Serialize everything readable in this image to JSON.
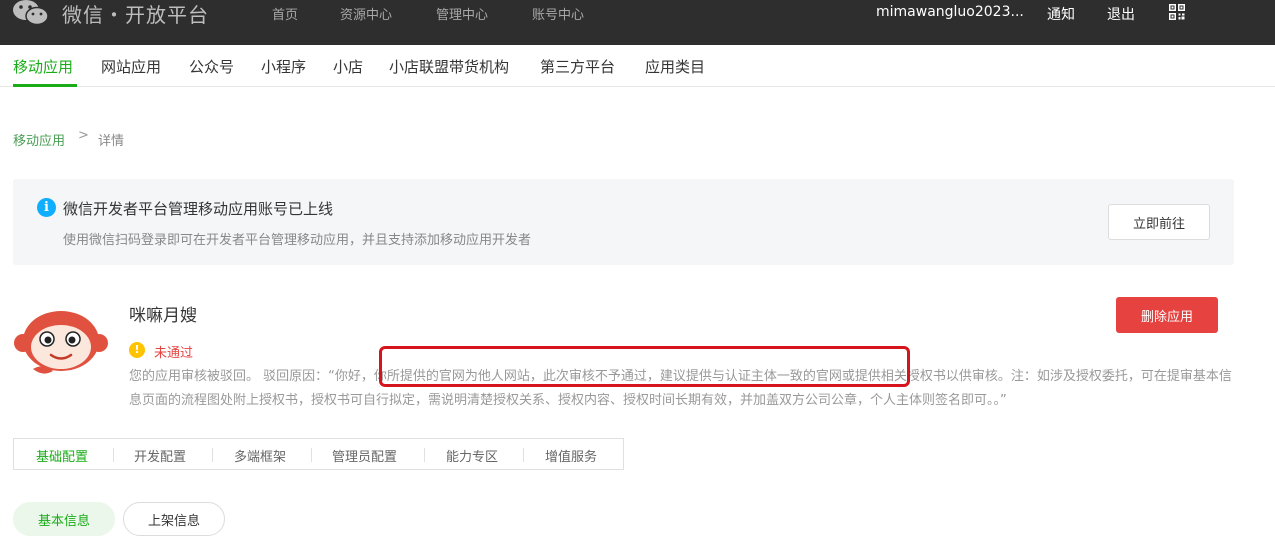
{
  "header": {
    "logo_icon": "wechat-logo-icon",
    "title": "微信・开放平台",
    "nav": [
      "首页",
      "资源中心",
      "管理中心",
      "账号中心"
    ],
    "username": "mimawangluo2023...",
    "notify": "通知",
    "logout": "退出",
    "qr_icon": "qrcode-icon"
  },
  "subnav": {
    "items": [
      "移动应用",
      "网站应用",
      "公众号",
      "小程序",
      "小店",
      "小店联盟带货机构",
      "第三方平台",
      "应用类目"
    ],
    "active_index": 0
  },
  "breadcrumb": {
    "parent": "移动应用",
    "separator": ">",
    "current": "详情"
  },
  "notice": {
    "icon": "info-icon",
    "title": "微信开发者平台管理移动应用账号已上线",
    "desc": "使用微信扫码登录即可在开发者平台管理移动应用，并且支持添加移动应用开发者",
    "button": "立即前往"
  },
  "app": {
    "avatar": "monkey-avatar",
    "name": "咪嘛月嫂",
    "status_icon": "warning-icon",
    "status": "未通过",
    "reject_reason": "您的应用审核被驳回。 驳回原因：“你好，你所提供的官网为他人网站，此次审核不予通过，建议提供与认证主体一致的官网或提供相关授权书以供审核。注：如涉及授权委托，可在提审基本信息页面的流程图处附上授权书，授权书可自行拟定，需说明清楚授权关系、授权内容、授权时间长期有效，并加盖双方公司公章，个人主体则签名即可。。”",
    "delete_button": "删除应用"
  },
  "tabs": {
    "items": [
      "基础配置",
      "开发配置",
      "多端框架",
      "管理员配置",
      "能力专区",
      "增值服务"
    ],
    "active_index": 0
  },
  "pills": {
    "items": [
      "基本信息",
      "上架信息"
    ],
    "active_index": 0
  },
  "colors": {
    "accent": "#1aad19",
    "danger": "#e64340",
    "info": "#10aeff",
    "warning": "#ffc300",
    "topbar": "#2e2e2e",
    "highlight": "#d6141c"
  }
}
